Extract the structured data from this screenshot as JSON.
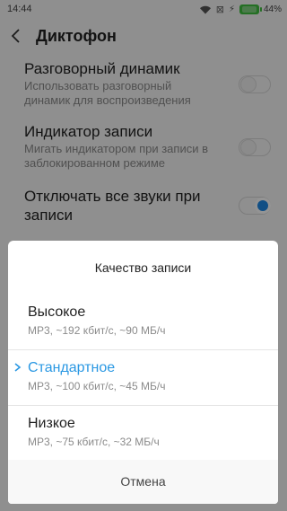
{
  "status_bar": {
    "time": "14:44",
    "battery_percent": "44%",
    "icons": [
      "wifi-icon",
      "no-sim-icon",
      "charging-icon",
      "battery-icon"
    ],
    "battery_color": "#3fbf3f"
  },
  "header": {
    "back_icon": "chevron-left-icon",
    "title": "Диктофон"
  },
  "settings": {
    "items": [
      {
        "title": "Разговорный динамик",
        "subtitle": "Использовать разговорный динамик для воспроизведения",
        "toggle_on": false
      },
      {
        "title": "Индикатор записи",
        "subtitle": "Мигать индикатором при записи в заблокированном режиме",
        "toggle_on": false
      },
      {
        "title": "Отключать все звуки при записи",
        "subtitle": "",
        "toggle_on": true
      }
    ]
  },
  "dialog": {
    "title": "Качество записи",
    "options": [
      {
        "label": "Высокое",
        "detail": "MP3, ~192 кбит/с, ~90 МБ/ч",
        "selected": false
      },
      {
        "label": "Стандартное",
        "detail": "MP3, ~100 кбит/с, ~45 МБ/ч",
        "selected": true
      },
      {
        "label": "Низкое",
        "detail": "MP3, ~75 кбит/с, ~32 МБ/ч",
        "selected": false
      }
    ],
    "cancel_label": "Отмена",
    "accent_color": "#2a98e3"
  }
}
